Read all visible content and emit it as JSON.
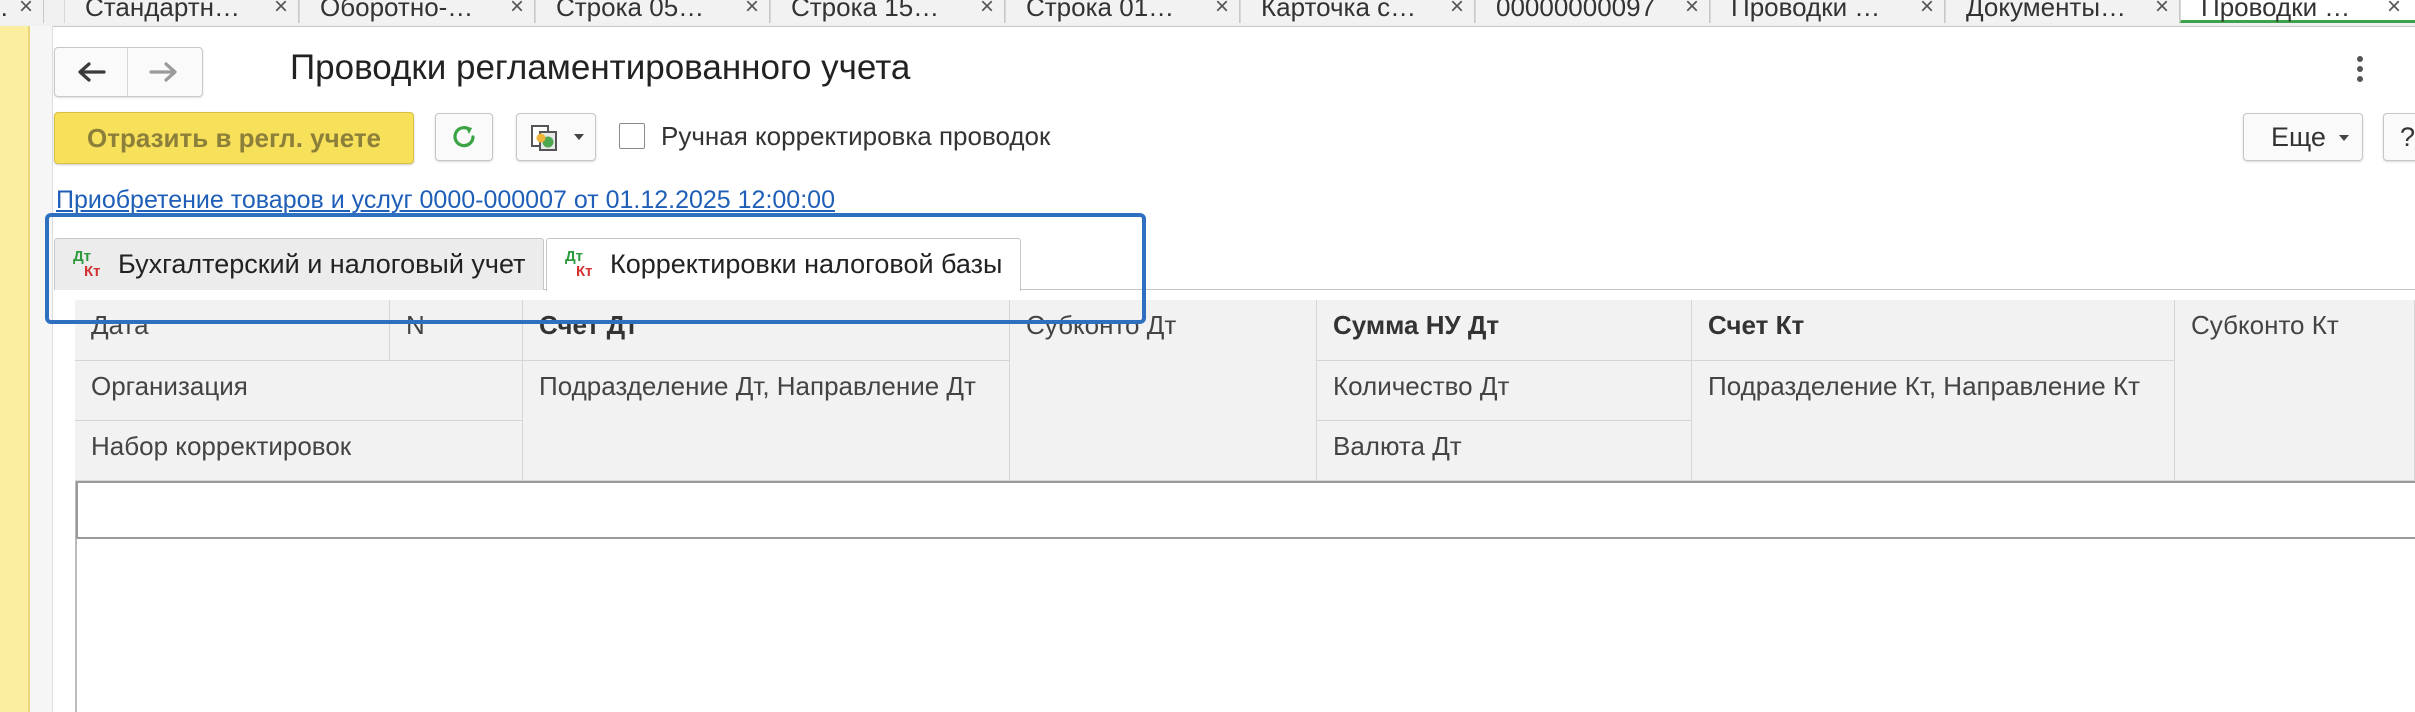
{
  "window_tabs": [
    {
      "label": "…",
      "active": false
    },
    {
      "label": "Стандартн…",
      "active": false
    },
    {
      "label": "Оборотно-…",
      "active": false
    },
    {
      "label": "Строка 05…",
      "active": false
    },
    {
      "label": "Строка 15…",
      "active": false
    },
    {
      "label": "Строка 01…",
      "active": false
    },
    {
      "label": "Карточка с…",
      "active": false
    },
    {
      "label": "00000000097",
      "active": false
    },
    {
      "label": "Проводки …",
      "active": false
    },
    {
      "label": "Документы…",
      "active": false
    },
    {
      "label": "Проводки …",
      "active": true
    }
  ],
  "window_tab_close_glyph": "×",
  "header": {
    "title": "Проводки регламентированного учета"
  },
  "toolbar": {
    "post_button_label": "Отразить в регл. учете",
    "manual_correction_label": "Ручная корректировка проводок",
    "manual_correction_checked": false,
    "more_label": "Еще",
    "help_label": "?"
  },
  "document_link": "Приобретение товаров и услуг 0000-000007 от 01.12.2025 12:00:00",
  "form_tabs": [
    {
      "label": "Бухгалтерский и налоговый учет",
      "icon_dt": "Дт",
      "icon_kt": "Кт",
      "active": false
    },
    {
      "label": "Корректировки налоговой базы",
      "icon_dt": "Дт",
      "icon_kt": "Кт",
      "active": true
    }
  ],
  "table": {
    "headers": {
      "date": "Дата",
      "n": "N",
      "account_dt": "Счет Дт",
      "subconto_dt": "Субконто Дт",
      "sum_nu_dt": "Сумма НУ Дт",
      "account_kt": "Счет Кт",
      "subconto_kt": "Субконто Кт",
      "organization": "Организация",
      "division_dt": "Подразделение Дт, Направление Дт",
      "quantity_dt": "Количество Дт",
      "division_kt": "Подразделение Кт, Направление Кт",
      "correction_set": "Набор корректировок",
      "currency_dt": "Валюта Дт"
    },
    "rows": []
  },
  "colors": {
    "accent_yellow": "#f7e15b",
    "link_blue": "#1f5fb8",
    "highlight_blue": "#2e6fc0",
    "active_tab_green": "#3fa14a",
    "dt_green": "#2e9a3e",
    "kt_red": "#d33232"
  }
}
